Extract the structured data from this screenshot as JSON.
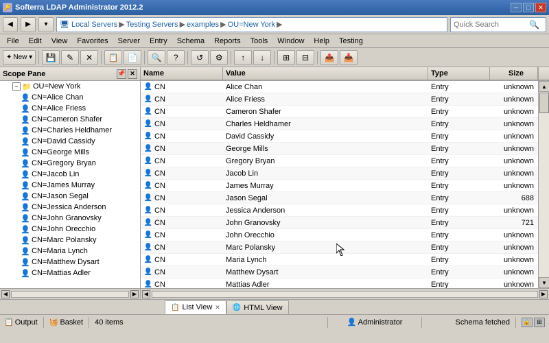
{
  "titleBar": {
    "title": "Softerra LDAP Administrator 2012.2",
    "icon": "🔑",
    "controls": [
      "─",
      "□",
      "✕"
    ]
  },
  "addressBar": {
    "breadcrumbs": [
      "Local Servers",
      "Testing Servers",
      "examples",
      "OU=New York"
    ],
    "searchPlaceholder": "Quick Search"
  },
  "menuBar": {
    "items": [
      "File",
      "Edit",
      "View",
      "Favorites",
      "Server",
      "Entry",
      "Schema",
      "Reports",
      "Tools",
      "Window",
      "Help",
      "Testing"
    ]
  },
  "toolbar": {
    "newLabel": "New ▾",
    "buttons": [
      "✕",
      "←",
      "→",
      "↑",
      "↓",
      "⊞",
      "✎",
      "⊟",
      "📋",
      "🔍",
      "?",
      "⚙"
    ]
  },
  "scopePane": {
    "title": "Scope Pane",
    "rootNode": "OU=New York",
    "items": [
      "CN=Alice Chan",
      "CN=Alice Friess",
      "CN=Cameron Shafer",
      "CN=Charles Heldhamer",
      "CN=David Cassidy",
      "CN=George Mills",
      "CN=Gregory Bryan",
      "CN=Jacob Lin",
      "CN=James Murray",
      "CN=Jason Segal",
      "CN=Jessica Anderson",
      "CN=John Granovsky",
      "CN=John Orecchio",
      "CN=Marc Polansky",
      "CN=Maria Lynch",
      "CN=Matthew Dysart",
      "CN=Mattias Adler"
    ]
  },
  "table": {
    "headers": [
      "Name",
      "Value",
      "Type",
      "Size"
    ],
    "rows": [
      {
        "name": "CN",
        "value": "Alice Chan",
        "type": "Entry",
        "size": "unknown"
      },
      {
        "name": "CN",
        "value": "Alice Friess",
        "type": "Entry",
        "size": "unknown"
      },
      {
        "name": "CN",
        "value": "Cameron Shafer",
        "type": "Entry",
        "size": "unknown"
      },
      {
        "name": "CN",
        "value": "Charles Heldhamer",
        "type": "Entry",
        "size": "unknown"
      },
      {
        "name": "CN",
        "value": "David Cassidy",
        "type": "Entry",
        "size": "unknown"
      },
      {
        "name": "CN",
        "value": "George Mills",
        "type": "Entry",
        "size": "unknown"
      },
      {
        "name": "CN",
        "value": "Gregory Bryan",
        "type": "Entry",
        "size": "unknown"
      },
      {
        "name": "CN",
        "value": "Jacob Lin",
        "type": "Entry",
        "size": "unknown"
      },
      {
        "name": "CN",
        "value": "James Murray",
        "type": "Entry",
        "size": "unknown"
      },
      {
        "name": "CN",
        "value": "Jason Segal",
        "type": "Entry",
        "size": "688"
      },
      {
        "name": "CN",
        "value": "Jessica Anderson",
        "type": "Entry",
        "size": "unknown"
      },
      {
        "name": "CN",
        "value": "John Granovsky",
        "type": "Entry",
        "size": "721"
      },
      {
        "name": "CN",
        "value": "John Orecchio",
        "type": "Entry",
        "size": "unknown"
      },
      {
        "name": "CN",
        "value": "Marc Polansky",
        "type": "Entry",
        "size": "unknown"
      },
      {
        "name": "CN",
        "value": "Maria Lynch",
        "type": "Entry",
        "size": "unknown"
      },
      {
        "name": "CN",
        "value": "Matthew Dysart",
        "type": "Entry",
        "size": "unknown"
      },
      {
        "name": "CN",
        "value": "Mattias Adler",
        "type": "Entry",
        "size": "unknown"
      }
    ]
  },
  "tabs": [
    {
      "label": "List View",
      "icon": "📋",
      "active": true,
      "closable": true
    },
    {
      "label": "HTML View",
      "icon": "🌐",
      "active": false,
      "closable": false
    }
  ],
  "statusBar": {
    "outputLabel": "Output",
    "basketLabel": "Basket",
    "itemCount": "40 items",
    "user": "Administrator",
    "schema": "Schema fetched"
  }
}
